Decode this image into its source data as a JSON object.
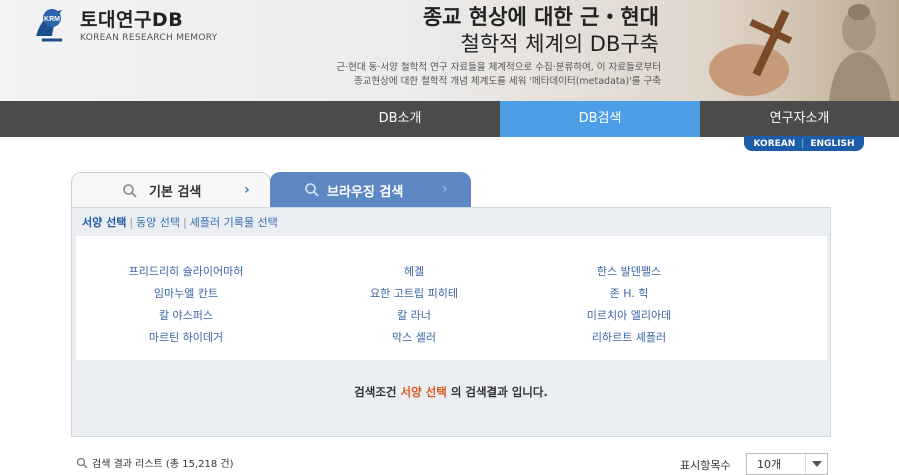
{
  "header": {
    "logo_title": "토대연구DB",
    "logo_subtitle": "KOREAN RESEARCH MEMORY",
    "headline_line1": "종교 현상에 대한 근・현대",
    "headline_line2": "철학적 체계의 DB구축",
    "desc_line1": "근·현대 동·서양 철학적 연구 자료들을 체계적으로 수집·분류하여, 이 자료들로부터",
    "desc_line2": "종교현상에 대한 철학적 개념 체계도를 세워 '메타데이터(metadata)'를 구축"
  },
  "nav": {
    "items": [
      "DB소개",
      "DB검색",
      "연구자소개"
    ]
  },
  "lang": {
    "korean": "KOREAN",
    "english": "ENGLISH"
  },
  "tabs": {
    "basic": "기본 검색",
    "browse": "브라우징 검색"
  },
  "subtabs": [
    "서양 선택",
    "동양 선택",
    "셰플러 기록물 선택"
  ],
  "names": [
    "프리드리히 슐라이어마허",
    "헤겔",
    "한스 발덴펠스",
    "임마누엘 칸트",
    "요한 고트립 피히테",
    "존 H. 힉",
    "칼 야스퍼스",
    "칼 라너",
    "미르치아 엘리아데",
    "마르틴 하이데거",
    "막스 셸러",
    "리하르트 셰플러"
  ],
  "result": {
    "prefix": "검색조건",
    "condition": "서양 선택",
    "suffix": "의 검색결과 입니다."
  },
  "list": {
    "title": "검색 결과 리스트 (총 15,218 건)",
    "per_page_label": "표시항목수",
    "per_page_value": "10개"
  },
  "colors": {
    "nav_bg": "#4b4b4b",
    "nav_active": "#4c9ee6",
    "tab_active": "#5e88c4",
    "highlight": "#d75b1e"
  }
}
